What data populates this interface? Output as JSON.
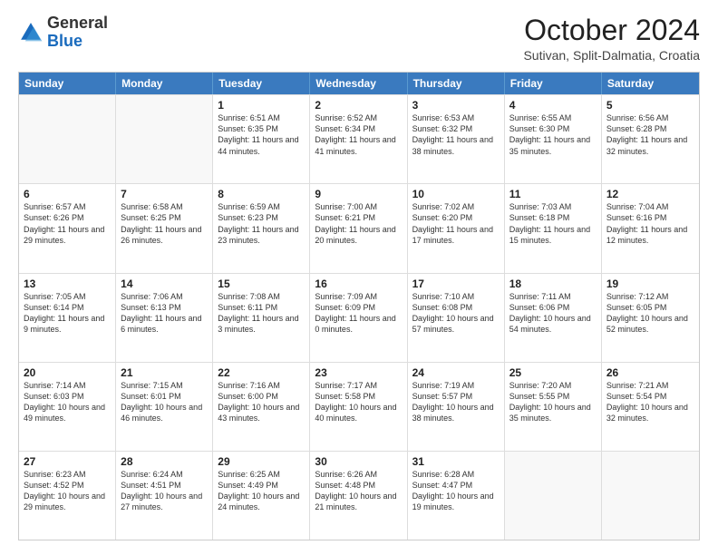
{
  "header": {
    "logo_general": "General",
    "logo_blue": "Blue",
    "month_title": "October 2024",
    "subtitle": "Sutivan, Split-Dalmatia, Croatia"
  },
  "calendar": {
    "days_of_week": [
      "Sunday",
      "Monday",
      "Tuesday",
      "Wednesday",
      "Thursday",
      "Friday",
      "Saturday"
    ],
    "rows": [
      [
        {
          "day": "",
          "info": "",
          "empty": true
        },
        {
          "day": "",
          "info": "",
          "empty": true
        },
        {
          "day": "1",
          "info": "Sunrise: 6:51 AM\nSunset: 6:35 PM\nDaylight: 11 hours and 44 minutes."
        },
        {
          "day": "2",
          "info": "Sunrise: 6:52 AM\nSunset: 6:34 PM\nDaylight: 11 hours and 41 minutes."
        },
        {
          "day": "3",
          "info": "Sunrise: 6:53 AM\nSunset: 6:32 PM\nDaylight: 11 hours and 38 minutes."
        },
        {
          "day": "4",
          "info": "Sunrise: 6:55 AM\nSunset: 6:30 PM\nDaylight: 11 hours and 35 minutes."
        },
        {
          "day": "5",
          "info": "Sunrise: 6:56 AM\nSunset: 6:28 PM\nDaylight: 11 hours and 32 minutes."
        }
      ],
      [
        {
          "day": "6",
          "info": "Sunrise: 6:57 AM\nSunset: 6:26 PM\nDaylight: 11 hours and 29 minutes."
        },
        {
          "day": "7",
          "info": "Sunrise: 6:58 AM\nSunset: 6:25 PM\nDaylight: 11 hours and 26 minutes."
        },
        {
          "day": "8",
          "info": "Sunrise: 6:59 AM\nSunset: 6:23 PM\nDaylight: 11 hours and 23 minutes."
        },
        {
          "day": "9",
          "info": "Sunrise: 7:00 AM\nSunset: 6:21 PM\nDaylight: 11 hours and 20 minutes."
        },
        {
          "day": "10",
          "info": "Sunrise: 7:02 AM\nSunset: 6:20 PM\nDaylight: 11 hours and 17 minutes."
        },
        {
          "day": "11",
          "info": "Sunrise: 7:03 AM\nSunset: 6:18 PM\nDaylight: 11 hours and 15 minutes."
        },
        {
          "day": "12",
          "info": "Sunrise: 7:04 AM\nSunset: 6:16 PM\nDaylight: 11 hours and 12 minutes."
        }
      ],
      [
        {
          "day": "13",
          "info": "Sunrise: 7:05 AM\nSunset: 6:14 PM\nDaylight: 11 hours and 9 minutes."
        },
        {
          "day": "14",
          "info": "Sunrise: 7:06 AM\nSunset: 6:13 PM\nDaylight: 11 hours and 6 minutes."
        },
        {
          "day": "15",
          "info": "Sunrise: 7:08 AM\nSunset: 6:11 PM\nDaylight: 11 hours and 3 minutes."
        },
        {
          "day": "16",
          "info": "Sunrise: 7:09 AM\nSunset: 6:09 PM\nDaylight: 11 hours and 0 minutes."
        },
        {
          "day": "17",
          "info": "Sunrise: 7:10 AM\nSunset: 6:08 PM\nDaylight: 10 hours and 57 minutes."
        },
        {
          "day": "18",
          "info": "Sunrise: 7:11 AM\nSunset: 6:06 PM\nDaylight: 10 hours and 54 minutes."
        },
        {
          "day": "19",
          "info": "Sunrise: 7:12 AM\nSunset: 6:05 PM\nDaylight: 10 hours and 52 minutes."
        }
      ],
      [
        {
          "day": "20",
          "info": "Sunrise: 7:14 AM\nSunset: 6:03 PM\nDaylight: 10 hours and 49 minutes."
        },
        {
          "day": "21",
          "info": "Sunrise: 7:15 AM\nSunset: 6:01 PM\nDaylight: 10 hours and 46 minutes."
        },
        {
          "day": "22",
          "info": "Sunrise: 7:16 AM\nSunset: 6:00 PM\nDaylight: 10 hours and 43 minutes."
        },
        {
          "day": "23",
          "info": "Sunrise: 7:17 AM\nSunset: 5:58 PM\nDaylight: 10 hours and 40 minutes."
        },
        {
          "day": "24",
          "info": "Sunrise: 7:19 AM\nSunset: 5:57 PM\nDaylight: 10 hours and 38 minutes."
        },
        {
          "day": "25",
          "info": "Sunrise: 7:20 AM\nSunset: 5:55 PM\nDaylight: 10 hours and 35 minutes."
        },
        {
          "day": "26",
          "info": "Sunrise: 7:21 AM\nSunset: 5:54 PM\nDaylight: 10 hours and 32 minutes."
        }
      ],
      [
        {
          "day": "27",
          "info": "Sunrise: 6:23 AM\nSunset: 4:52 PM\nDaylight: 10 hours and 29 minutes."
        },
        {
          "day": "28",
          "info": "Sunrise: 6:24 AM\nSunset: 4:51 PM\nDaylight: 10 hours and 27 minutes."
        },
        {
          "day": "29",
          "info": "Sunrise: 6:25 AM\nSunset: 4:49 PM\nDaylight: 10 hours and 24 minutes."
        },
        {
          "day": "30",
          "info": "Sunrise: 6:26 AM\nSunset: 4:48 PM\nDaylight: 10 hours and 21 minutes."
        },
        {
          "day": "31",
          "info": "Sunrise: 6:28 AM\nSunset: 4:47 PM\nDaylight: 10 hours and 19 minutes."
        },
        {
          "day": "",
          "info": "",
          "empty": true
        },
        {
          "day": "",
          "info": "",
          "empty": true
        }
      ]
    ]
  }
}
